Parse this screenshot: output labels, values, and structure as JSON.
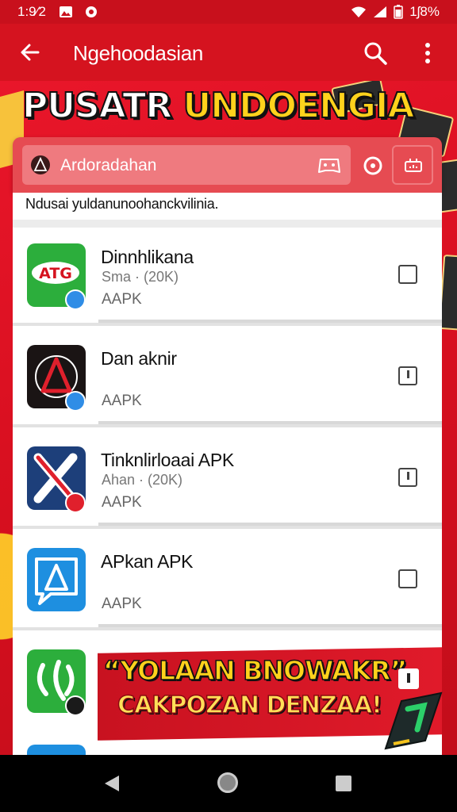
{
  "status_bar": {
    "time": "1:9⁄2",
    "battery": "1ʃ8%",
    "icons": [
      "gallery-icon",
      "settings-icon",
      "wifi-icon",
      "signal-icon",
      "battery-icon"
    ]
  },
  "toolbar": {
    "title": "Ngehoodasian"
  },
  "banner": {
    "headline_word1": "PUSATR",
    "headline_word2": "UNDOENGIA"
  },
  "search": {
    "placeholder": "Ardoradahan"
  },
  "list": {
    "caption": "Ndusai yuldanunoohanckvilinia.",
    "items": [
      {
        "name": "Dinnhlikana",
        "size": "Sma · (20K)",
        "type": "AAPK",
        "checkbox": "empty"
      },
      {
        "name": "Dan  aknir",
        "size": "",
        "type": "AAPK",
        "checkbox": "partial"
      },
      {
        "name": "Tinknlirloaai APK",
        "size": "Ahan · (20K)",
        "type": "AAPK",
        "checkbox": "partial"
      },
      {
        "name": "APkan APK",
        "size": "",
        "type": "AAPK",
        "checkbox": "empty"
      }
    ]
  },
  "promo": {
    "line1": "“YOLAAN BNOWAKR”",
    "line2": "CAKPOZAN DENZAA!"
  },
  "colors": {
    "primary_red": "#d5131f",
    "accent_yellow": "#ffd21c"
  }
}
